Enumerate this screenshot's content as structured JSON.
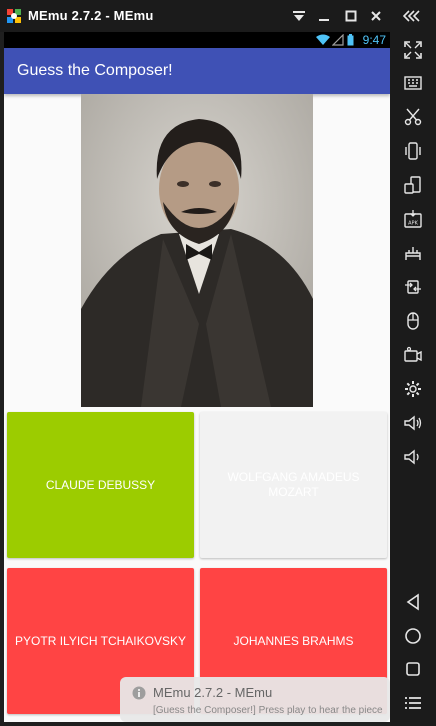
{
  "window": {
    "title": "MEmu 2.7.2 - MEmu"
  },
  "statusbar": {
    "time": "9:47"
  },
  "app": {
    "title": "Guess the Composer!"
  },
  "answers": [
    {
      "label": "CLAUDE DEBUSSY",
      "color": "#9ccc00",
      "text_color": "#ffffff",
      "state": "correct"
    },
    {
      "label": "WOLFGANG AMADEUS MOZART",
      "color": "#f2f2f2",
      "text_color": "#ffffff",
      "state": "neutral"
    },
    {
      "label": "PYOTR ILYICH TCHAIKOVSKY",
      "color": "#ff4444",
      "text_color": "#ffffff",
      "state": "wrong"
    },
    {
      "label": "JOHANNES BRAHMS",
      "color": "#ff4444",
      "text_color": "#ffffff",
      "state": "wrong"
    }
  ],
  "toast": {
    "title": "MEmu 2.7.2 - MEmu",
    "body": "[Guess the Composer!] Press play to hear the piece"
  },
  "colors": {
    "appbar": "#3f51b5",
    "window_chrome": "#1b1b1b",
    "status_icons": "#4fc3f7"
  },
  "toolbar_icons": [
    "collapse-icon",
    "fullscreen-icon",
    "keyboard-icon",
    "scissors-icon",
    "shake-icon",
    "rotate-icon",
    "apk-icon",
    "network-icon",
    "sync-icon",
    "mouse-icon",
    "video-icon",
    "settings-icon",
    "volume-up-icon",
    "volume-down-icon",
    "back-icon",
    "home-icon",
    "recents-icon",
    "menu-icon"
  ]
}
